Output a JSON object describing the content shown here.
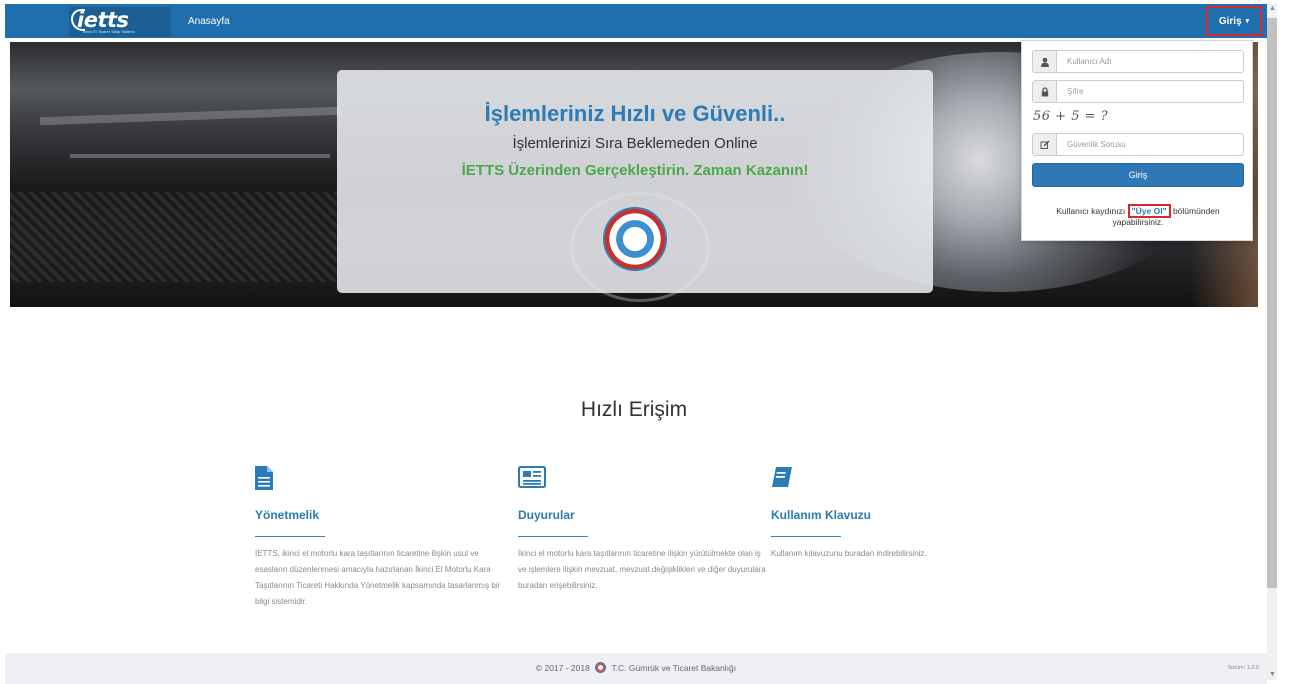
{
  "navbar": {
    "logo_text": "ietts",
    "logo_sub": "İkinci El Ticaret Takip Sistemi",
    "home_label": "Anasayfa",
    "login_label": "Giriş",
    "login_caret": "▾"
  },
  "hero": {
    "title": "İşlemleriniz Hızlı ve Güvenli..",
    "subtitle": "İşlemlerinizi Sıra Beklemeden Online",
    "cta": "İETTS Üzerinden Gerçekleştirin. Zaman Kazanın!"
  },
  "login_form": {
    "username_placeholder": "Kullanıcı Adı",
    "password_placeholder": "Şifre",
    "captcha_text": "56 + 5 = ?",
    "security_placeholder": "Güvenlik Sorusu",
    "submit_label": "Giriş",
    "register_prefix": "Kullanıcı kaydınızı ",
    "register_link": "\"Üye Ol\"",
    "register_suffix": " bölümünden yapabilirsiniz.",
    "icons": [
      "user-icon",
      "lock-icon",
      "edit-icon"
    ]
  },
  "quick_access": {
    "title": "Hızlı Erişim",
    "items": [
      {
        "icon": "document-icon",
        "name": "Yönetmelik",
        "desc": "İETTS, ikinci el motorlu kara taşıtlarının ticaretine ilişkin usul ve esasların düzenlenmesi amacıyla hazırlanan İkinci El Motorlu Kara Taşıtlarının Ticareti Hakkında Yönetmelik kapsamında tasarlanmış bir bilgi sistemidir."
      },
      {
        "icon": "newspaper-icon",
        "name": "Duyurular",
        "desc": "İkinci el motorlu kara taşıtlarının ticaretine ilişkin yürütülmekte olan iş ve işlemlere ilişkin mevzuat, mevzuat değişiklikleri ve diğer duyurulara buradan erişebilirsiniz."
      },
      {
        "icon": "book-icon",
        "name": "Kullanım Klavuzu",
        "desc": "Kullanım kılavuzunu buradan indirebilirsiniz."
      }
    ]
  },
  "footer": {
    "copyright_prefix": "© 2017 - 2018",
    "ministry": "T.C. Gümrük ve Ticaret Bakanlığı",
    "version": "Sürüm: 1.0.0"
  },
  "colors": {
    "navbar": "#1f6fae",
    "accent": "#2a7bb6",
    "green": "#4aa84a",
    "highlight_red": "#d8282b"
  }
}
